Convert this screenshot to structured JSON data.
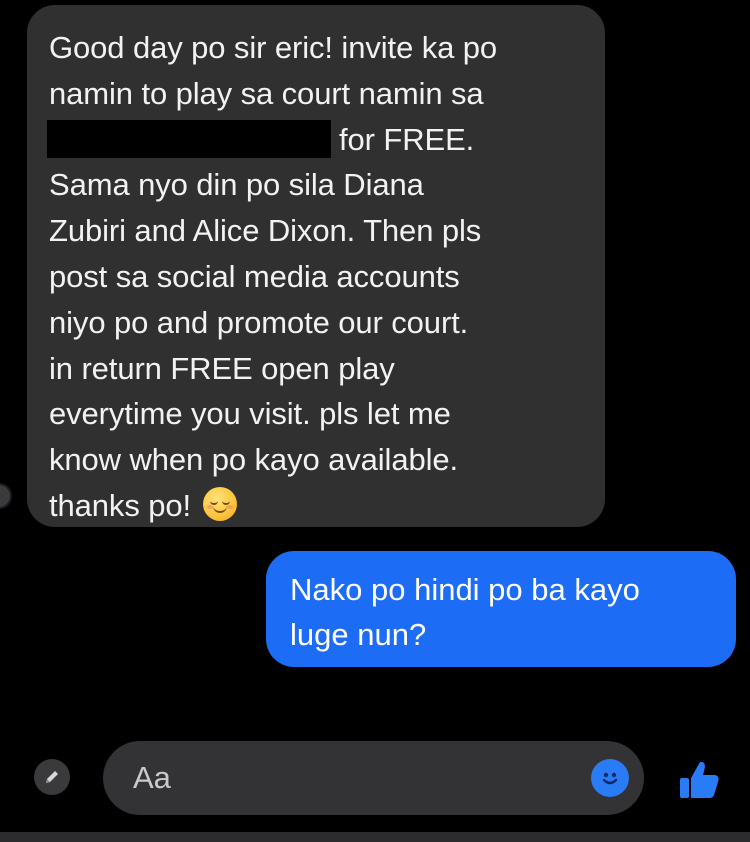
{
  "conversation": {
    "incoming": {
      "lines": [
        "Good day po sir eric! invite ka po",
        "namin to play sa court namin sa",
        "for FREE.",
        "Sama nyo din po sila Diana",
        "Zubiri and Alice Dixon. Then pls",
        "post sa social media accounts",
        "niyo po and promote our court.",
        "in return FREE open play",
        "everytime you visit. pls let me",
        "know when po kayo available.",
        "thanks po!"
      ],
      "emoji": "smiling-face-icon"
    },
    "outgoing": {
      "lines": [
        "Nako po hindi po ba kayo",
        "luge nun?"
      ]
    }
  },
  "composer": {
    "placeholder": "Aa",
    "edit_icon": "pencil-icon",
    "emoji_icon": "emoji-icon",
    "send_icon": "thumbs-up-icon",
    "accent_color": "#1c6cf5"
  }
}
